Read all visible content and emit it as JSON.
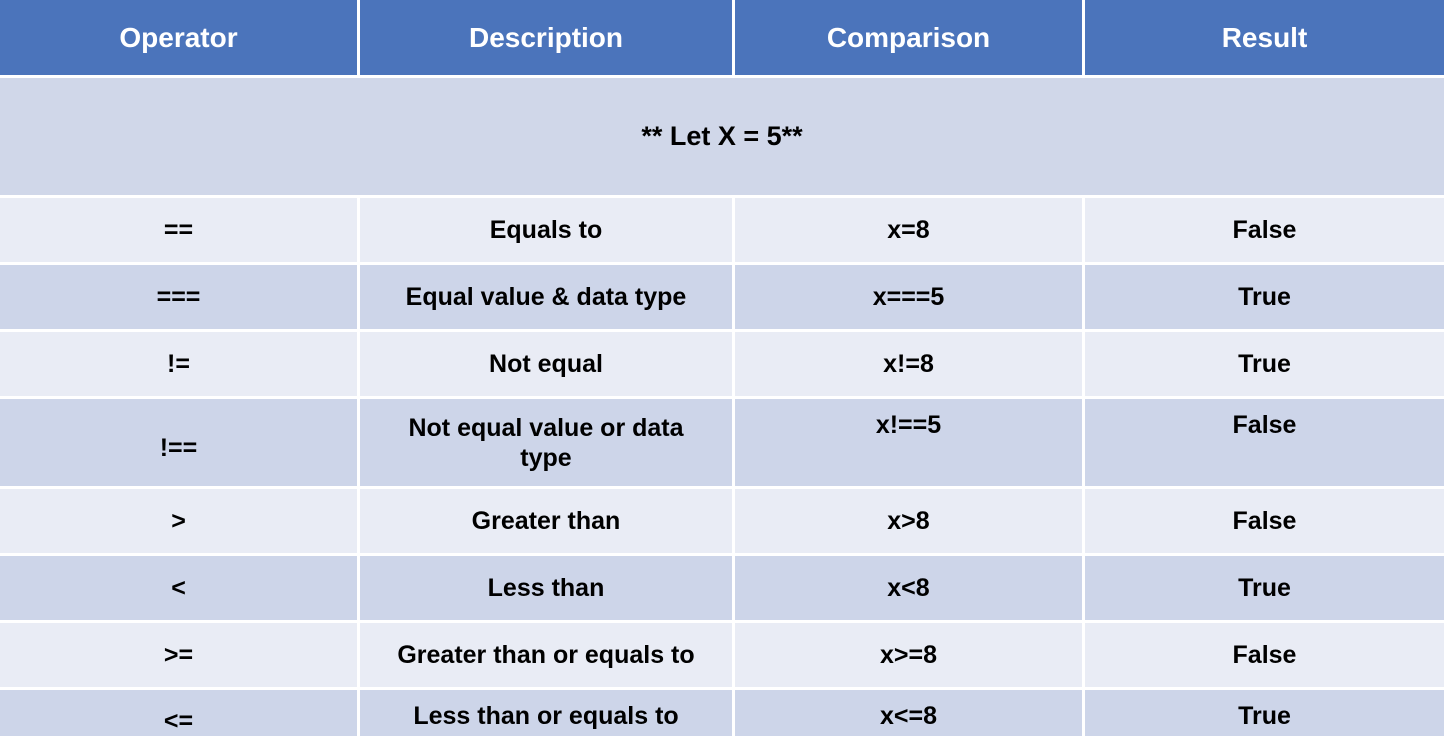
{
  "headers": {
    "operator": "Operator",
    "description": "Description",
    "comparison": "Comparison",
    "result": "Result"
  },
  "note": "** Let X = 5**",
  "rows": [
    {
      "operator": "==",
      "description": "Equals to",
      "comparison": "x=8",
      "result": "False"
    },
    {
      "operator": "===",
      "description": "Equal value & data type",
      "comparison": "x===5",
      "result": "True"
    },
    {
      "operator": "!=",
      "description": "Not equal",
      "comparison": "x!=8",
      "result": "True"
    },
    {
      "operator": "!==",
      "description": "Not equal value or data type",
      "comparison": "x!==5",
      "result": "False"
    },
    {
      "operator": ">",
      "description": "Greater than",
      "comparison": "x>8",
      "result": "False"
    },
    {
      "operator": "<",
      "description": "Less than",
      "comparison": "x<8",
      "result": "True"
    },
    {
      "operator": ">=",
      "description": "Greater than or equals to",
      "comparison": "x>=8",
      "result": "False"
    },
    {
      "operator": "<=",
      "description": "Less than or equals to",
      "comparison": "x<=8",
      "result": "True"
    }
  ],
  "chart_data": {
    "type": "table",
    "title": "** Let X = 5**",
    "columns": [
      "Operator",
      "Description",
      "Comparison",
      "Result"
    ],
    "rows": [
      [
        "==",
        "Equals to",
        "x=8",
        "False"
      ],
      [
        "===",
        "Equal value & data type",
        "x===5",
        "True"
      ],
      [
        "!=",
        "Not equal",
        "x!=8",
        "True"
      ],
      [
        "!==",
        "Not equal value or data type",
        "x!==5",
        "False"
      ],
      [
        ">",
        "Greater than",
        "x>8",
        "False"
      ],
      [
        "<",
        "Less than",
        "x<8",
        "True"
      ],
      [
        ">=",
        "Greater than or equals to",
        "x>=8",
        "False"
      ],
      [
        "<=",
        "Less than or equals to",
        "x<=8",
        "True"
      ]
    ]
  }
}
